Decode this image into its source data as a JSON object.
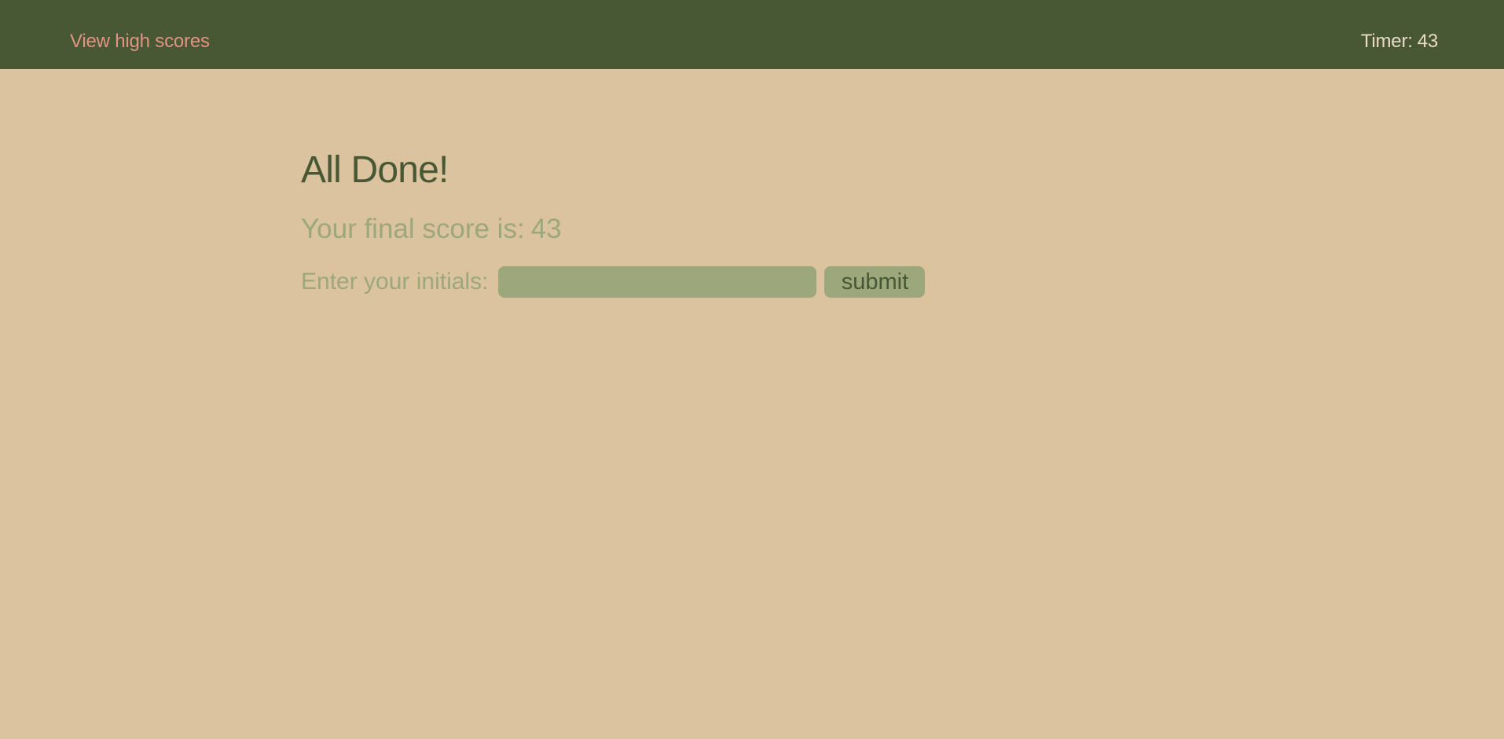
{
  "header": {
    "high_scores_link": "View high scores",
    "timer_label": "Timer:",
    "timer_value": "43"
  },
  "main": {
    "title": "All Done!",
    "final_score_label": "Your final score is:",
    "final_score_value": "43",
    "initials_label": "Enter your initials:",
    "initials_value": "",
    "initials_placeholder": "",
    "submit_label": "submit"
  },
  "colors": {
    "page_background": "#dbc39f",
    "header_background": "#485734",
    "link": "#e09482",
    "timer_text": "#e8dcc6",
    "title_text": "#485734",
    "muted_text": "#9ca77b",
    "input_background": "#9ca77b"
  }
}
